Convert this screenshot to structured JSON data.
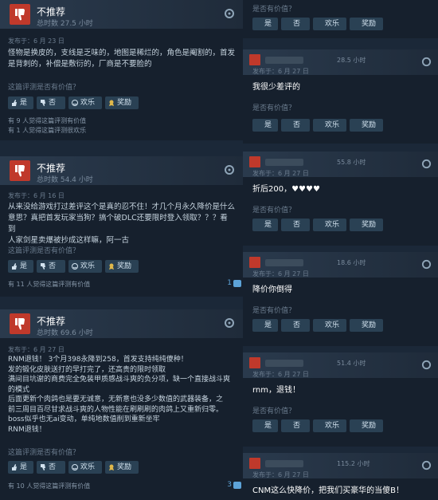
{
  "left_reviews": [
    {
      "verdict": "不推荐",
      "hours": "总时数 27.5 小时",
      "posted": "发布于：6 月 23 日",
      "body": [
        "怪物是换皮的，支线是乏味的，地图是稀烂的，角色是阉割的，首发",
        "是背刺的，补偿是敷衍的，厂商是不要脸的"
      ],
      "ask": "这篇评测是否有价值？",
      "yes": "是",
      "no": "否",
      "funny": "欢乐",
      "award": "奖励",
      "stats": [
        "有 9 人觉得这篇评测有价值",
        "有 1 人觉得这篇评测很欢乐"
      ],
      "comments": ""
    },
    {
      "verdict": "不推荐",
      "hours": "总时数 54.4 小时",
      "posted": "发布于：6 月 16 日",
      "body": [
        "从来没给游戏打过差评这个是真的忍不住！才几个月永久降价是什么",
        "意思？真把首发玩家当狗？搞个破DLC还要限时登入领取？？？看到",
        "人家剑星卖爆被抄成这样嘛，阿一古"
      ],
      "ask": "这篇评测是否有价值？",
      "yes": "是",
      "no": "否",
      "funny": "欢乐",
      "award": "奖励",
      "stats": [
        "有 11 人觉得这篇评测有价值"
      ],
      "comments": "1"
    },
    {
      "verdict": "不推荐",
      "hours": "总时数 69.6 小时",
      "posted": "发布于：6 月 27 日",
      "body": [
        "RNM退钱！ 3个月398永降到258，首发支持纯纯傻种！",
        "发的锻化皮肤送打的早打完了，还高贵的限时领取",
        "满间目坑谢的商费完全免装甲质感战斗爽的负分项，缺一个直接战斗爽",
        "的模式",
        "后面更新个肉鸽也是要无诚意，无新意也没多少数值的武器装备，之",
        "前三周目百尽甘求战斗爽的人物性能在刷刷刷的肉鸽上又重新归零。",
        "boss似乎也无ai变动，单纯地数值削到重新坐牢",
        "RNM退钱！"
      ],
      "ask": "这篇评测是否有价值？",
      "yes": "是",
      "no": "否",
      "funny": "欢乐",
      "award": "奖励",
      "stats": [
        "有 10 人觉得这篇评测有价值"
      ],
      "comments": "3"
    }
  ],
  "right_reviews": [
    {
      "hours": "",
      "posted": "",
      "text": "",
      "ask": "是否有价值？",
      "yes": "是",
      "no": "否",
      "funny": "欢乐",
      "award": "奖励"
    },
    {
      "hours": "28.5 小时",
      "posted": "发布于：6 月 27 日",
      "text": "我很少差评的",
      "ask": "是否有价值？",
      "yes": "是",
      "no": "否",
      "funny": "欢乐",
      "award": "奖励"
    },
    {
      "hours": "55.8 小时",
      "posted": "发布于：6 月 27 日",
      "text": "折后200，♥♥♥♥",
      "ask": "是否有价值？",
      "yes": "是",
      "no": "否",
      "funny": "欢乐",
      "award": "奖励"
    },
    {
      "hours": "18.6 小时",
      "posted": "发布于：6 月 27 日",
      "text": "降价你倒得",
      "ask": "是否有价值？",
      "yes": "是",
      "no": "否",
      "funny": "欢乐",
      "award": "奖励"
    },
    {
      "hours": "51.4 小时",
      "posted": "发布于：6 月 27 日",
      "text": "rnm，退钱！",
      "ask": "是否有价值？",
      "yes": "是",
      "no": "否",
      "funny": "欢乐",
      "award": "奖励"
    },
    {
      "hours": "115.2 小时",
      "posted": "发布于：6 月 27 日",
      "text": "CNM这么快降价，把我们买豪华的当傻B！",
      "ask": "",
      "yes": "",
      "no": "",
      "funny": "",
      "award": ""
    }
  ]
}
